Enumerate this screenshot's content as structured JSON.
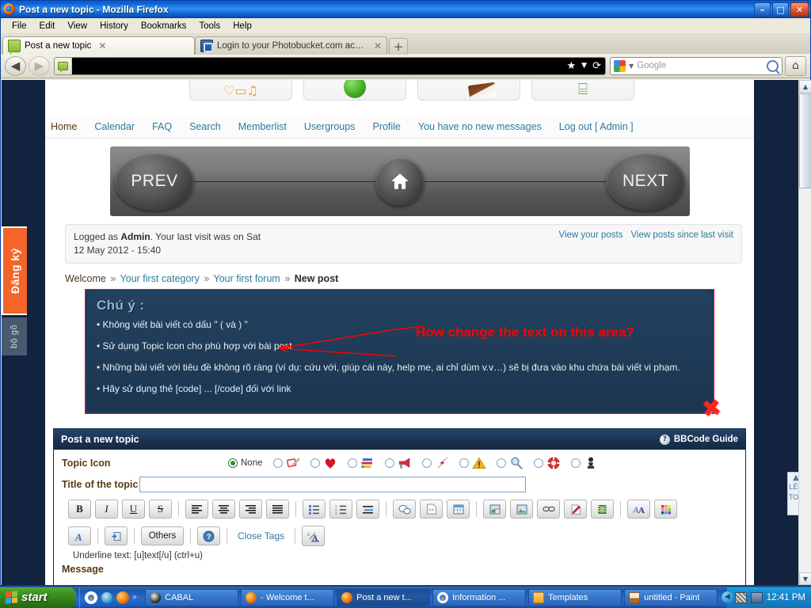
{
  "window": {
    "title": "Post a new topic - Mozilla Firefox",
    "minimize": "–",
    "maximize": "□",
    "close": "✕"
  },
  "menubar": [
    "File",
    "Edit",
    "View",
    "History",
    "Bookmarks",
    "Tools",
    "Help"
  ],
  "tabs": [
    {
      "label": "Post a new topic",
      "close": "✕",
      "active": true
    },
    {
      "label": "Login to your Photobucket.com account",
      "close": "✕",
      "active": false
    }
  ],
  "newtab_label": "+",
  "navbar": {
    "back": "◀",
    "forward": "▶",
    "url_value": "",
    "star": "★",
    "caret": "▼",
    "reload": "⟳",
    "search_placeholder": "Google",
    "search_caret": "▼",
    "home": "⌂"
  },
  "sidebar": {
    "register_tab": "Đăng ký",
    "ime_tab": "bộ gõ"
  },
  "forum_nav": [
    {
      "label": "Home",
      "current": true
    },
    {
      "label": "Calendar",
      "current": false
    },
    {
      "label": "FAQ",
      "current": false
    },
    {
      "label": "Search",
      "current": false
    },
    {
      "label": "Memberlist",
      "current": false
    },
    {
      "label": "Usergroups",
      "current": false
    },
    {
      "label": "Profile",
      "current": false
    },
    {
      "label": "You have no new messages",
      "current": false
    },
    {
      "label": "Log out [ Admin ]",
      "current": false
    }
  ],
  "pager": {
    "prev": "PREV",
    "next": "NEXT",
    "home_icon": "home-icon"
  },
  "logged_box": {
    "line1_pre": "Logged as ",
    "user": "Admin",
    "line1_post": ". Your last visit was on Sat",
    "line2": "12 May 2012 - 15:40",
    "links": [
      "View your posts",
      "View posts since last visit"
    ]
  },
  "breadcrumb": {
    "root": "Welcome",
    "sep": "»",
    "category": "Your first category",
    "forum": "Your first forum",
    "current": "New post"
  },
  "notice": {
    "heading": "Chú ý :",
    "rules": [
      "• Không viết bài viết có dấu \" ( và ) \"",
      "• Sử dụng Topic Icon cho phù hợp với bài post",
      "• Những bài viết với tiêu đề không rõ ràng (ví dụ: cứu với, giúp cái này, help me, ai chỉ dùm v.v…) sẽ bị đưa vào khu chứa bài viết vi phạm.",
      "• Hãy sử dụng thẻ [code] ... [/code] đối với link"
    ],
    "annotation": "How change the text on this area?",
    "annotation_color": "#ff0000",
    "mark": "✖",
    "border_color": "#e01b1b",
    "bg_color": "#1d3b5c"
  },
  "post_panel": {
    "title": "Post a new topic",
    "bbcode_guide": "BBCode Guide",
    "topic_icon_label": "Topic Icon",
    "none_label": "None",
    "topic_icons": [
      {
        "name": "none-option",
        "selected": true
      },
      {
        "name": "notepad-pencil-icon",
        "selected": false
      },
      {
        "name": "heart-icon",
        "selected": false
      },
      {
        "name": "colored-bars-icon",
        "selected": false
      },
      {
        "name": "megaphone-icon",
        "selected": false
      },
      {
        "name": "red-arrow-icon",
        "selected": false
      },
      {
        "name": "warning-triangle-icon",
        "selected": false
      },
      {
        "name": "magnifier-icon",
        "selected": false
      },
      {
        "name": "lifebuoy-icon",
        "selected": false
      },
      {
        "name": "chess-pawn-icon",
        "selected": false
      }
    ],
    "title_field_label": "Title of the topic",
    "title_field_value": "",
    "toolbar_row1": [
      {
        "name": "bold-button",
        "label": "B"
      },
      {
        "name": "italic-button",
        "label": "I"
      },
      {
        "name": "underline-button",
        "label": "U"
      },
      {
        "name": "strikethrough-button",
        "label": "S"
      },
      {
        "name": "separator",
        "label": ""
      },
      {
        "name": "align-left-button",
        "label": "≡"
      },
      {
        "name": "align-center-button",
        "label": "≡"
      },
      {
        "name": "align-right-button",
        "label": "≡"
      },
      {
        "name": "align-justify-button",
        "label": "≡"
      },
      {
        "name": "separator",
        "label": ""
      },
      {
        "name": "bullet-list-button",
        "label": "☰"
      },
      {
        "name": "numbered-list-button",
        "label": "☰"
      },
      {
        "name": "indent-button",
        "label": "≡"
      },
      {
        "name": "separator",
        "label": ""
      },
      {
        "name": "quote-button",
        "label": "❞"
      },
      {
        "name": "code-button",
        "label": "<>"
      },
      {
        "name": "table-button",
        "label": "▤"
      },
      {
        "name": "separator",
        "label": ""
      },
      {
        "name": "save-image-button",
        "label": "▣"
      },
      {
        "name": "insert-image-button",
        "label": "▣"
      },
      {
        "name": "insert-link-button",
        "label": "⛓"
      },
      {
        "name": "edit-pen-button",
        "label": "✎"
      },
      {
        "name": "insert-video-button",
        "label": "▦"
      },
      {
        "name": "separator",
        "label": ""
      },
      {
        "name": "font-button",
        "label": "A"
      },
      {
        "name": "color-palette-button",
        "label": "▩"
      }
    ],
    "toolbar_row2": [
      {
        "name": "font-size-button",
        "label": "A"
      },
      {
        "name": "separator",
        "label": ""
      },
      {
        "name": "insert-flash-button",
        "label": "⊞"
      },
      {
        "name": "separator",
        "label": ""
      },
      {
        "name": "others-button",
        "label": "Others"
      },
      {
        "name": "separator",
        "label": ""
      },
      {
        "name": "help-button",
        "label": "?"
      },
      {
        "name": "separator",
        "label": ""
      },
      {
        "name": "close-tags-link",
        "label": "Close Tags"
      },
      {
        "name": "separator",
        "label": ""
      },
      {
        "name": "toggle-wysiwyg-button",
        "label": "AA"
      }
    ],
    "hint": "Underline text: [u]text[/u] (ctrl+u)",
    "message_label": "Message"
  },
  "scroll_top_widget": {
    "arrow": "▲",
    "line1": "LÊN",
    "line2": "TOP"
  },
  "scrollbar": {
    "up": "▲",
    "down": "▼"
  },
  "taskbar": {
    "start_label": "start",
    "quicklaunch": [
      {
        "name": "chrome-icon"
      },
      {
        "name": "internet-explorer-icon"
      },
      {
        "name": "firefox-icon"
      }
    ],
    "quicklaunch_chevron": "»",
    "tasks": [
      {
        "label": "CABAL",
        "icon": "cabal-icon",
        "active": false
      },
      {
        "label": "- Welcome t...",
        "icon": "firefox-icon",
        "active": false
      },
      {
        "label": "Post a new t...",
        "icon": "firefox-icon",
        "active": true
      },
      {
        "label": "Information ...",
        "icon": "chrome-icon",
        "active": false
      },
      {
        "label": "Templates",
        "icon": "folder-icon",
        "active": false
      },
      {
        "label": "untitled - Paint",
        "icon": "paint-icon",
        "active": false
      }
    ],
    "tray_chevron": "◀",
    "clock": "12:41 PM"
  }
}
